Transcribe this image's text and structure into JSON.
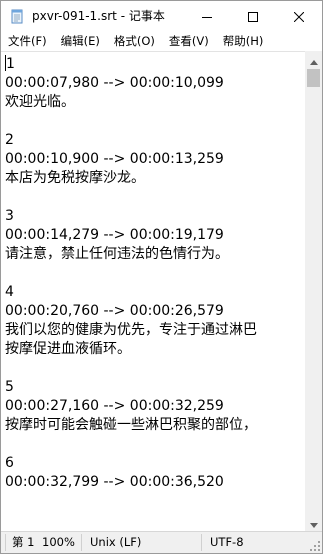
{
  "window": {
    "title": "pxvr-091-1.srt - 记事本",
    "minimize_icon": "minimize-icon",
    "maximize_icon": "maximize-icon",
    "close_icon": "close-icon"
  },
  "menu": {
    "items": [
      {
        "label": "文件(F)"
      },
      {
        "label": "编辑(E)"
      },
      {
        "label": "格式(O)"
      },
      {
        "label": "查看(V)"
      },
      {
        "label": "帮助(H)"
      }
    ]
  },
  "editor": {
    "lines": [
      "1",
      "00:00:07,980 --> 00:00:10,099",
      "欢迎光临。",
      "",
      "2",
      "00:00:10,900 --> 00:00:13,259",
      "本店为免税按摩沙龙。",
      "",
      "3",
      "00:00:14,279 --> 00:00:19,179",
      "请注意，禁止任何违法的色情行为。",
      "",
      "4",
      "00:00:20,760 --> 00:00:26,579",
      "我们以您的健康为优先，专注于通过淋巴",
      "按摩促进血液循环。",
      "",
      "5",
      "00:00:27,160 --> 00:00:32,259",
      "按摩时可能会触碰一些淋巴积聚的部位，",
      "",
      "6",
      "00:00:32,799 --> 00:00:36,520",
      "",
      ""
    ]
  },
  "status": {
    "position": "第 1",
    "zoom": "100%",
    "line_ending": "Unix (LF)",
    "encoding": "UTF-8"
  }
}
